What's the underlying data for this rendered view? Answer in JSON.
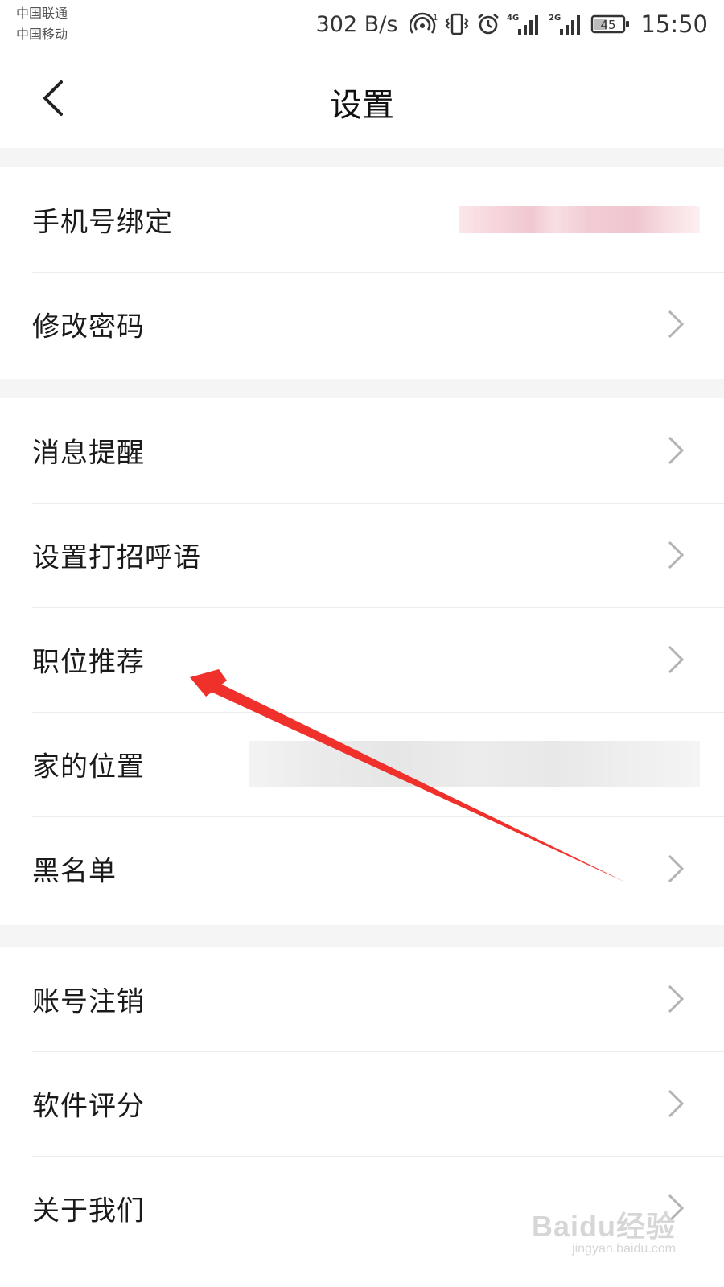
{
  "status_bar": {
    "carrier_1": "中国联通",
    "carrier_2": "中国移动",
    "net_speed": "302 B/s",
    "network_1": "4G",
    "network_2": "2G",
    "battery": "45",
    "time": "15:50",
    "icons": [
      "hotspot-icon",
      "vibrate-icon",
      "alarm-icon",
      "signal-4g-icon",
      "signal-2g-icon",
      "battery-icon"
    ]
  },
  "nav": {
    "title": "设置",
    "back_icon": "chevron-left-icon"
  },
  "groups": [
    {
      "items": [
        {
          "label": "手机号绑定",
          "value_redacted": true,
          "chevron": false
        },
        {
          "label": "修改密码",
          "chevron": true
        }
      ]
    },
    {
      "items": [
        {
          "label": "消息提醒",
          "chevron": true
        },
        {
          "label": "设置打招呼语",
          "chevron": true
        },
        {
          "label": "职位推荐",
          "chevron": true
        },
        {
          "label": "家的位置",
          "value_redacted": true,
          "chevron": false
        },
        {
          "label": "黑名单",
          "chevron": true
        }
      ]
    },
    {
      "items": [
        {
          "label": "账号注销",
          "chevron": true
        },
        {
          "label": "软件评分",
          "chevron": true
        },
        {
          "label": "关于我们",
          "chevron": true
        }
      ]
    }
  ],
  "annotation": {
    "arrow_color": "#f0302a",
    "points_to": "职位推荐"
  },
  "watermark": {
    "logo": "Baidu经验",
    "url": "jingyan.baidu.com"
  },
  "colors": {
    "background": "#f5f5f5",
    "surface": "#ffffff",
    "divider": "#ececec",
    "chevron": "#b3b3b3"
  }
}
